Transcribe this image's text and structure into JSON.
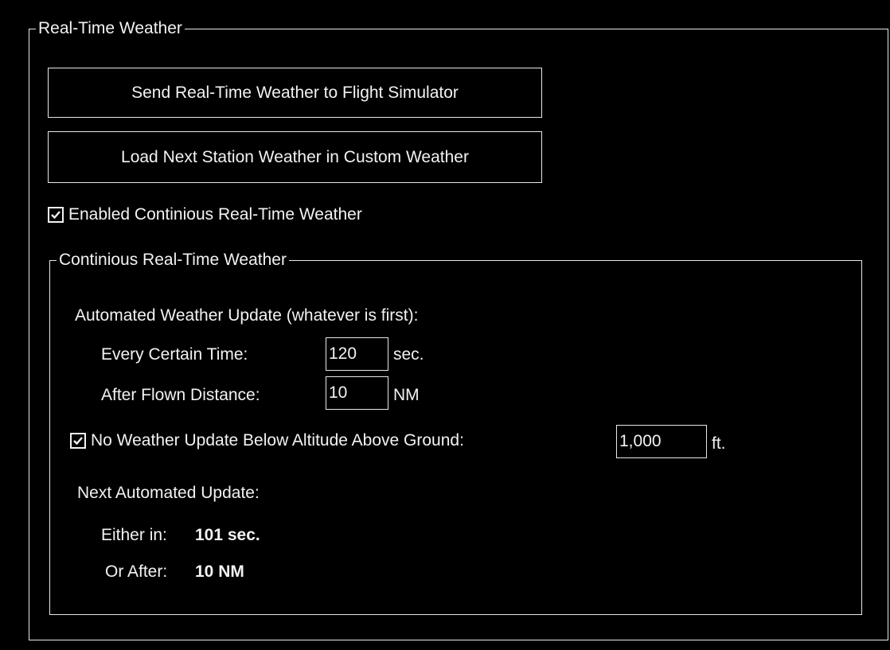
{
  "realtime_group": {
    "title": "Real-Time Weather",
    "send_button": "Send Real-Time Weather to Flight Simulator",
    "load_button": "Load Next Station Weather in Custom Weather",
    "enable_continuous": {
      "label": "Enabled Continious Real-Time Weather",
      "checked": true
    }
  },
  "continuous_group": {
    "title": "Continious Real-Time Weather",
    "auto_update_heading": "Automated Weather Update (whatever is first):",
    "every_time": {
      "label": "Every Certain Time:",
      "value": "120",
      "unit": "sec."
    },
    "flown_distance": {
      "label": "After Flown Distance:",
      "value": "10",
      "unit": "NM"
    },
    "no_update_below": {
      "label": "No Weather Update Below Altitude Above Ground:",
      "checked": true,
      "value": "1,000",
      "unit": "ft."
    },
    "next_update": {
      "heading": "Next Automated Update:",
      "either_label": "Either in:",
      "either_value": "101 sec.",
      "or_label": "Or After:",
      "or_value": "10 NM"
    }
  },
  "colors": {
    "background": "#000000",
    "foreground": "#f2f2f2",
    "border": "#e8e8e8"
  }
}
